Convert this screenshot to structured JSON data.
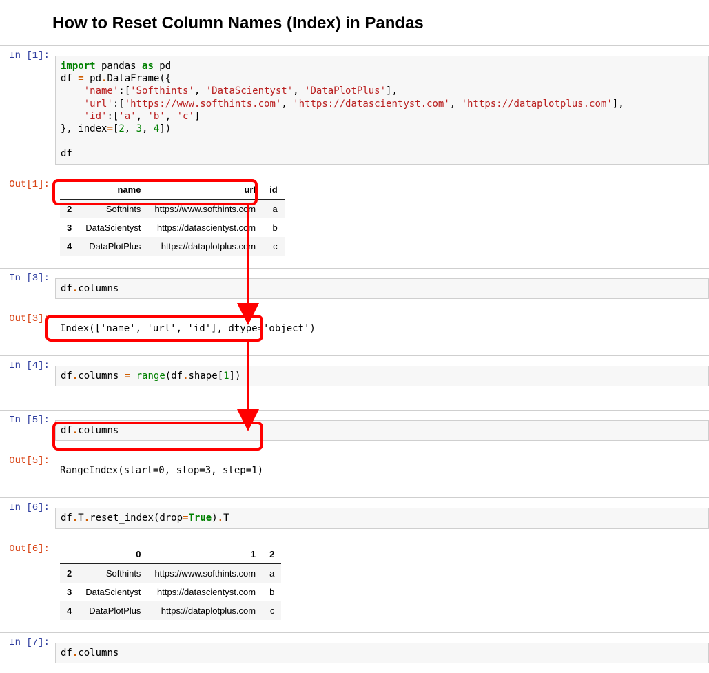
{
  "title": "How to Reset Column Names (Index) in Pandas",
  "cells": {
    "c1": {
      "in_label": "In [1]:",
      "out_label": "Out[1]:",
      "code_html": "<span class='kw'>import</span> pandas <span class='kw'>as</span> pd\ndf <span class='op'>=</span> pd<span class='op'>.</span>DataFrame({\n    <span class='str'>'name'</span>:[<span class='str'>'Softhints'</span>, <span class='str'>'DataScientyst'</span>, <span class='str'>'DataPlotPlus'</span>],\n    <span class='str'>'url'</span>:[<span class='str'>'https://www.softhints.com'</span>, <span class='str'>'https://datascientyst.com'</span>, <span class='str'>'https://dataplotplus.com'</span>],\n    <span class='str'>'id'</span>:[<span class='str'>'a'</span>, <span class='str'>'b'</span>, <span class='str'>'c'</span>]\n}, index<span class='op'>=</span>[<span class='num'>2</span>, <span class='num'>3</span>, <span class='num'>4</span>])\n\ndf",
      "table": {
        "headers": [
          "",
          "name",
          "url",
          "id"
        ],
        "rows": [
          [
            "2",
            "Softhints",
            "https://www.softhints.com",
            "a"
          ],
          [
            "3",
            "DataScientyst",
            "https://datascientyst.com",
            "b"
          ],
          [
            "4",
            "DataPlotPlus",
            "https://dataplotplus.com",
            "c"
          ]
        ]
      }
    },
    "c3": {
      "in_label": "In [3]:",
      "out_label": "Out[3]:",
      "code_html": "df<span class='op'>.</span>columns",
      "output": "Index(['name', 'url', 'id'], dtype='object')"
    },
    "c4": {
      "in_label": "In [4]:",
      "code_html": "df<span class='op'>.</span>columns <span class='op'>=</span> <span class='bn'>range</span>(df<span class='op'>.</span>shape[<span class='num'>1</span>])"
    },
    "c5": {
      "in_label": "In [5]:",
      "out_label": "Out[5]:",
      "code_html": "df<span class='op'>.</span>columns",
      "output": "RangeIndex(start=0, stop=3, step=1)"
    },
    "c6": {
      "in_label": "In [6]:",
      "out_label": "Out[6]:",
      "code_html": "df<span class='op'>.</span>T<span class='op'>.</span>reset_index(drop<span class='op'>=</span><span class='bool'>True</span>)<span class='op'>.</span>T",
      "table": {
        "headers": [
          "",
          "0",
          "1",
          "2"
        ],
        "rows": [
          [
            "2",
            "Softhints",
            "https://www.softhints.com",
            "a"
          ],
          [
            "3",
            "DataScientyst",
            "https://datascientyst.com",
            "b"
          ],
          [
            "4",
            "DataPlotPlus",
            "https://dataplotplus.com",
            "c"
          ]
        ]
      }
    },
    "c7": {
      "in_label": "In [7]:",
      "code_html": "df<span class='op'>.</span>columns"
    }
  }
}
